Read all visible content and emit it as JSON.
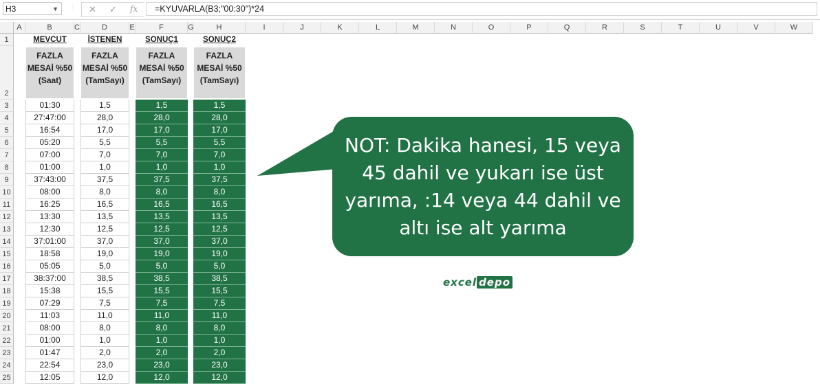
{
  "namebox": "H3",
  "formula": "=KYUVARLA(B3;\"00:30\")*24",
  "columns": [
    "A",
    "B",
    "C",
    "D",
    "E",
    "F",
    "G",
    "H",
    "I",
    "J",
    "K",
    "L",
    "M",
    "N",
    "O",
    "P",
    "Q",
    "R",
    "S",
    "T",
    "U",
    "V",
    "W"
  ],
  "headers": {
    "b_title": "MEVCUT",
    "b_label": "FAZLA MESAİ %50 (Saat)",
    "d_title": "İSTENEN",
    "d_label": "FAZLA MESAİ %50 (TamSayı)",
    "f_title": "SONUÇ1",
    "f_label": "FAZLA MESAİ %50 (TamSayı)",
    "h_title": "SONUÇ2",
    "h_label": "FAZLA MESAİ %50 (TamSayı)"
  },
  "rows": [
    {
      "n": "3",
      "b": "01:30",
      "d": "1,5",
      "f": "1,5",
      "h": "1,5"
    },
    {
      "n": "4",
      "b": "27:47:00",
      "d": "28,0",
      "f": "28,0",
      "h": "28,0"
    },
    {
      "n": "5",
      "b": "16:54",
      "d": "17,0",
      "f": "17,0",
      "h": "17,0"
    },
    {
      "n": "6",
      "b": "05:20",
      "d": "5,5",
      "f": "5,5",
      "h": "5,5"
    },
    {
      "n": "7",
      "b": "07:00",
      "d": "7,0",
      "f": "7,0",
      "h": "7,0"
    },
    {
      "n": "8",
      "b": "01:00",
      "d": "1,0",
      "f": "1,0",
      "h": "1,0"
    },
    {
      "n": "9",
      "b": "37:43:00",
      "d": "37,5",
      "f": "37,5",
      "h": "37,5"
    },
    {
      "n": "10",
      "b": "08:00",
      "d": "8,0",
      "f": "8,0",
      "h": "8,0"
    },
    {
      "n": "11",
      "b": "16:25",
      "d": "16,5",
      "f": "16,5",
      "h": "16,5"
    },
    {
      "n": "12",
      "b": "13:30",
      "d": "13,5",
      "f": "13,5",
      "h": "13,5"
    },
    {
      "n": "13",
      "b": "12:30",
      "d": "12,5",
      "f": "12,5",
      "h": "12,5"
    },
    {
      "n": "14",
      "b": "37:01:00",
      "d": "37,0",
      "f": "37,0",
      "h": "37,0"
    },
    {
      "n": "15",
      "b": "18:58",
      "d": "19,0",
      "f": "19,0",
      "h": "19,0"
    },
    {
      "n": "16",
      "b": "05:05",
      "d": "5,0",
      "f": "5,0",
      "h": "5,0"
    },
    {
      "n": "17",
      "b": "38:37:00",
      "d": "38,5",
      "f": "38,5",
      "h": "38,5"
    },
    {
      "n": "18",
      "b": "15:38",
      "d": "15,5",
      "f": "15,5",
      "h": "15,5"
    },
    {
      "n": "19",
      "b": "07:29",
      "d": "7,5",
      "f": "7,5",
      "h": "7,5"
    },
    {
      "n": "20",
      "b": "11:03",
      "d": "11,0",
      "f": "11,0",
      "h": "11,0"
    },
    {
      "n": "21",
      "b": "08:00",
      "d": "8,0",
      "f": "8,0",
      "h": "8,0"
    },
    {
      "n": "22",
      "b": "01:00",
      "d": "1,0",
      "f": "1,0",
      "h": "1,0"
    },
    {
      "n": "23",
      "b": "01:47",
      "d": "2,0",
      "f": "2,0",
      "h": "2,0"
    },
    {
      "n": "24",
      "b": "22:54",
      "d": "23,0",
      "f": "23,0",
      "h": "23,0"
    },
    {
      "n": "25",
      "b": "12:05",
      "d": "12,0",
      "f": "12,0",
      "h": "12,0"
    }
  ],
  "callout": "NOT: Dakika hanesi, 15 veya 45 dahil ve yukarı ise üst yarıma, :14 veya 44 dahil ve altı ise alt yarıma",
  "logo": {
    "part1": "excel",
    "part2": "depo"
  },
  "accent_color": "#217346"
}
